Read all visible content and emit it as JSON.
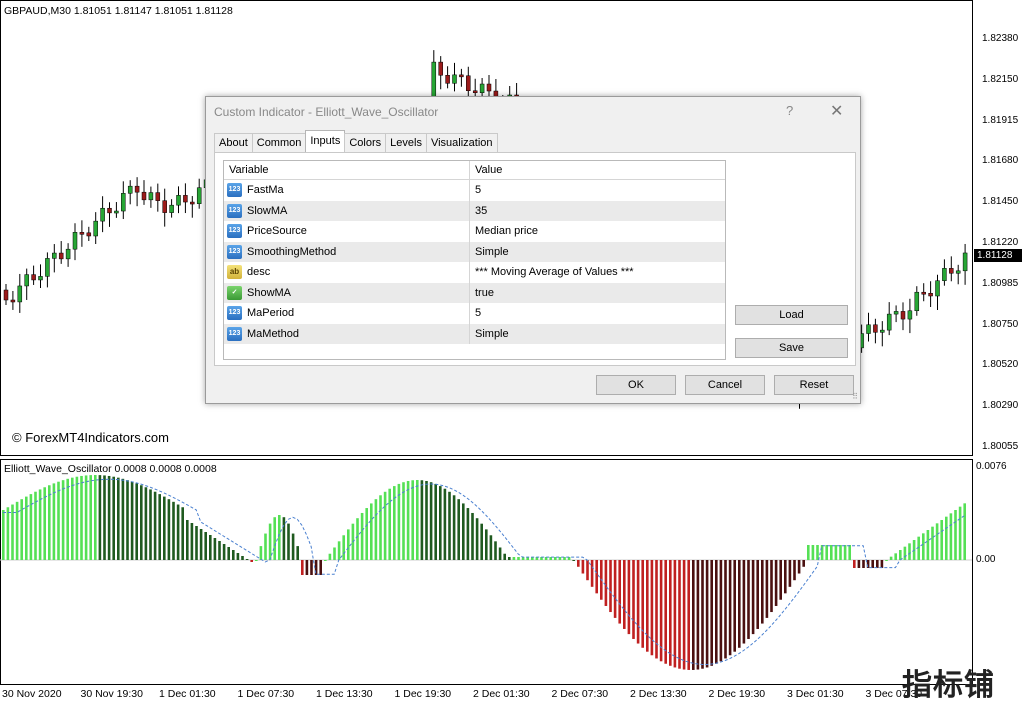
{
  "chart": {
    "symbol_header": "GBPAUD,M30  1.81051 1.81147 1.81051 1.81128",
    "copyright": "© ForexMT4Indicators.com",
    "current_price": "1.81128",
    "price_ticks": [
      "1.82380",
      "1.82150",
      "1.81915",
      "1.81680",
      "1.81450",
      "1.81220",
      "1.80985",
      "1.80750",
      "1.80520",
      "1.80290",
      "1.80055"
    ],
    "time_ticks": [
      "30 Nov 2020",
      "30 Nov 19:30",
      "1 Dec 01:30",
      "1 Dec 07:30",
      "1 Dec 13:30",
      "1 Dec 19:30",
      "2 Dec 01:30",
      "2 Dec 07:30",
      "2 Dec 13:30",
      "2 Dec 19:30",
      "3 Dec 01:30",
      "3 Dec 07:30"
    ],
    "colors": {
      "bull": "#27a635",
      "bear": "#9b1b1b",
      "osc_up_bright": "#55e055",
      "osc_up_dark": "#1f5a1f",
      "osc_down_dark": "#4a1010",
      "osc_down_bright": "#c02020",
      "signal_line": "#4a80d0"
    }
  },
  "indicator": {
    "header": "Elliott_Wave_Oscillator 0.0008 0.0008 0.0008",
    "scale_top": "0.0076",
    "scale_zero": "0.00"
  },
  "watermark": "指标铺",
  "dialog": {
    "title": "Custom Indicator - Elliott_Wave_Oscillator",
    "help": "?",
    "close": "✕",
    "tabs": [
      {
        "label": "About",
        "active": false
      },
      {
        "label": "Common",
        "active": false
      },
      {
        "label": "Inputs",
        "active": true
      },
      {
        "label": "Colors",
        "active": false
      },
      {
        "label": "Levels",
        "active": false
      },
      {
        "label": "Visualization",
        "active": false
      }
    ],
    "columns": [
      "Variable",
      "Value"
    ],
    "rows": [
      {
        "icon": "number-param-icon",
        "badge": "123",
        "variable": "FastMa",
        "value": "5"
      },
      {
        "icon": "number-param-icon",
        "badge": "123",
        "variable": "SlowMA",
        "value": "35"
      },
      {
        "icon": "number-param-icon",
        "badge": "123",
        "variable": "PriceSource",
        "value": "Median price"
      },
      {
        "icon": "number-param-icon",
        "badge": "123",
        "variable": "SmoothingMethod",
        "value": "Simple"
      },
      {
        "icon": "string-param-icon",
        "badge": "ab",
        "variable": "desc",
        "value": "*** Moving Average of Values ***"
      },
      {
        "icon": "bool-param-icon",
        "badge": "✓",
        "variable": "ShowMA",
        "value": "true"
      },
      {
        "icon": "number-param-icon",
        "badge": "123",
        "variable": "MaPeriod",
        "value": "5"
      },
      {
        "icon": "number-param-icon",
        "badge": "123",
        "variable": "MaMethod",
        "value": "Simple"
      }
    ],
    "buttons": {
      "load": "Load",
      "save": "Save",
      "ok": "OK",
      "cancel": "Cancel",
      "reset": "Reset"
    }
  }
}
